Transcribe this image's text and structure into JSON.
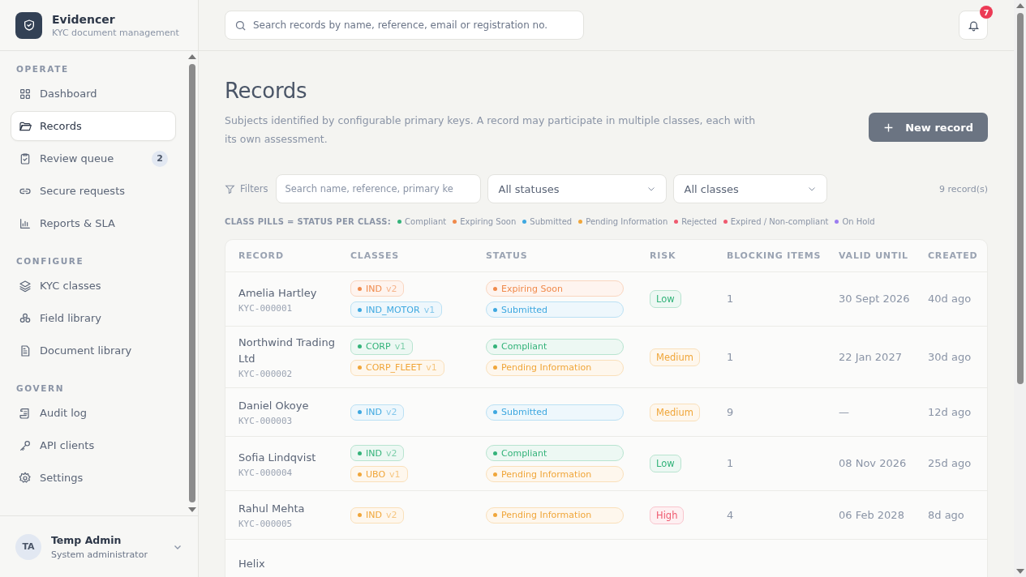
{
  "brand": {
    "title": "Evidencer",
    "subtitle": "KYC document management"
  },
  "sidebar": {
    "sections": [
      {
        "title": "OPERATE",
        "items": [
          {
            "label": "Dashboard",
            "selected": false
          },
          {
            "label": "Records",
            "selected": true
          },
          {
            "label": "Review queue",
            "selected": false,
            "badge": "2"
          },
          {
            "label": "Secure requests",
            "selected": false
          },
          {
            "label": "Reports & SLA",
            "selected": false
          }
        ]
      },
      {
        "title": "CONFIGURE",
        "items": [
          {
            "label": "KYC classes",
            "selected": false
          },
          {
            "label": "Field library",
            "selected": false
          },
          {
            "label": "Document library",
            "selected": false
          }
        ]
      },
      {
        "title": "GOVERN",
        "items": [
          {
            "label": "Audit log",
            "selected": false
          },
          {
            "label": "API clients",
            "selected": false
          },
          {
            "label": "Settings",
            "selected": false
          }
        ]
      }
    ],
    "user": {
      "initials": "TA",
      "name": "Temp Admin",
      "role": "System administrator"
    }
  },
  "topbar": {
    "search": {
      "placeholder": "Search records by name, reference, email or registration no."
    },
    "notifications": "7"
  },
  "page": {
    "title": "Records",
    "description": "Subjects identified by configurable primary keys. A record may participate in multiple classes, each with its own assessment.",
    "primary_button": "New record"
  },
  "filters": {
    "label": "Filters",
    "search": {
      "placeholder": "Search name, reference, primary ke"
    },
    "status": "All statuses",
    "classes": "All classes",
    "count": "9 record(s)"
  },
  "legend": {
    "title": "CLASS PILLS = STATUS PER CLASS:",
    "items": [
      {
        "label": "Compliant",
        "color": "#34b37a"
      },
      {
        "label": "Expiring Soon",
        "color": "#f08a4b"
      },
      {
        "label": "Submitted",
        "color": "#3ea8e0"
      },
      {
        "label": "Pending Information",
        "color": "#f0a63a"
      },
      {
        "label": "Rejected",
        "color": "#ef5a6f"
      },
      {
        "label": "Expired / Non-compliant",
        "color": "#ef5a6f"
      },
      {
        "label": "On Hold",
        "color": "#9b7cf0"
      }
    ]
  },
  "table": {
    "columns": [
      "RECORD",
      "CLASSES",
      "STATUS",
      "RISK",
      "BLOCKING ITEMS",
      "VALID UNTIL",
      "CREATED"
    ],
    "rows": [
      {
        "name": "Amelia Hartley",
        "ref": "KYC-000001",
        "classes": [
          {
            "code": "IND",
            "version": "v2",
            "color": "#f08a4b"
          },
          {
            "code": "IND_MOTOR",
            "version": "v1",
            "color": "#3ea8e0"
          }
        ],
        "statuses": [
          {
            "label": "Expiring Soon",
            "color": "#f08a4b"
          },
          {
            "label": "Submitted",
            "color": "#3ea8e0"
          }
        ],
        "risk": {
          "label": "Low",
          "color": "#34b37a"
        },
        "blocking": "1",
        "valid_until": "30 Sept 2026",
        "created": "40d ago"
      },
      {
        "name": "Northwind Trading Ltd",
        "ref": "KYC-000002",
        "classes": [
          {
            "code": "CORP",
            "version": "v1",
            "color": "#34b37a"
          },
          {
            "code": "CORP_FLEET",
            "version": "v1",
            "color": "#f0a63a"
          }
        ],
        "statuses": [
          {
            "label": "Compliant",
            "color": "#34b37a"
          },
          {
            "label": "Pending Information",
            "color": "#f0a63a"
          }
        ],
        "risk": {
          "label": "Medium",
          "color": "#f0a63a"
        },
        "blocking": "1",
        "valid_until": "22 Jan 2027",
        "created": "30d ago"
      },
      {
        "name": "Daniel Okoye",
        "ref": "KYC-000003",
        "classes": [
          {
            "code": "IND",
            "version": "v2",
            "color": "#3ea8e0"
          }
        ],
        "statuses": [
          {
            "label": "Submitted",
            "color": "#3ea8e0"
          }
        ],
        "risk": {
          "label": "Medium",
          "color": "#f0a63a"
        },
        "blocking": "9",
        "valid_until": "—",
        "created": "12d ago"
      },
      {
        "name": "Sofia Lindqvist",
        "ref": "KYC-000004",
        "classes": [
          {
            "code": "IND",
            "version": "v2",
            "color": "#34b37a"
          },
          {
            "code": "UBO",
            "version": "v1",
            "color": "#f0a63a"
          }
        ],
        "statuses": [
          {
            "label": "Compliant",
            "color": "#34b37a"
          },
          {
            "label": "Pending Information",
            "color": "#f0a63a"
          }
        ],
        "risk": {
          "label": "Low",
          "color": "#34b37a"
        },
        "blocking": "1",
        "valid_until": "08 Nov 2026",
        "created": "25d ago"
      },
      {
        "name": "Rahul Mehta",
        "ref": "KYC-000005",
        "classes": [
          {
            "code": "IND",
            "version": "v2",
            "color": "#f0a63a"
          }
        ],
        "statuses": [
          {
            "label": "Pending Information",
            "color": "#f0a63a"
          }
        ],
        "risk": {
          "label": "High",
          "color": "#ef5a6f"
        },
        "blocking": "4",
        "valid_until": "06 Feb 2028",
        "created": "8d ago"
      },
      {
        "name": "Helix"
      }
    ]
  }
}
